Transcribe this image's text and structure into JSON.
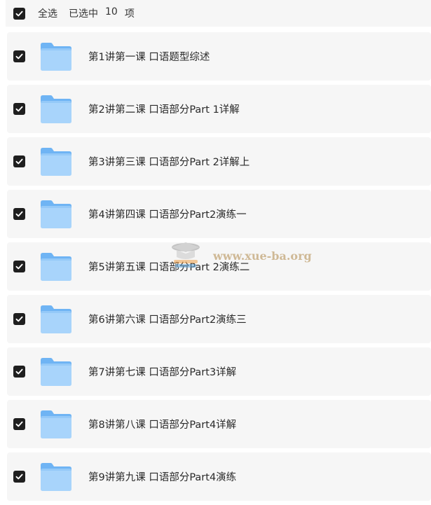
{
  "header": {
    "select_all_label": "全选",
    "selected_prefix": "已选中",
    "selected_count": "10",
    "selected_suffix": "项"
  },
  "items": [
    {
      "label": "第1讲第一课 口语题型综述",
      "checked": true,
      "icon": "folder-icon"
    },
    {
      "label": "第2讲第二课 口语部分Part 1详解",
      "checked": true,
      "icon": "folder-icon"
    },
    {
      "label": "第3讲第三课 口语部分Part 2详解上",
      "checked": true,
      "icon": "folder-icon"
    },
    {
      "label": "第4讲第四课 口语部分Part2演练一",
      "checked": true,
      "icon": "folder-icon"
    },
    {
      "label": "第5讲第五课 口语部分Part 2演练二",
      "checked": true,
      "icon": "folder-icon"
    },
    {
      "label": "第6讲第六课 口语部分Part2演练三",
      "checked": true,
      "icon": "folder-icon"
    },
    {
      "label": "第7讲第七课 口语部分Part3详解",
      "checked": true,
      "icon": "folder-icon"
    },
    {
      "label": "第8讲第八课 口语部分Part4详解",
      "checked": true,
      "icon": "folder-icon"
    },
    {
      "label": "第9讲第九课 口语部分Part4演练",
      "checked": true,
      "icon": "folder-icon"
    }
  ],
  "watermark": {
    "text": "www.xue-ba.org"
  },
  "colors": {
    "checkbox": "#1f1f1f",
    "row_background": "#f6f6f6",
    "folder_light": "#a8d4fb",
    "folder_dark": "#6fb4f4"
  }
}
